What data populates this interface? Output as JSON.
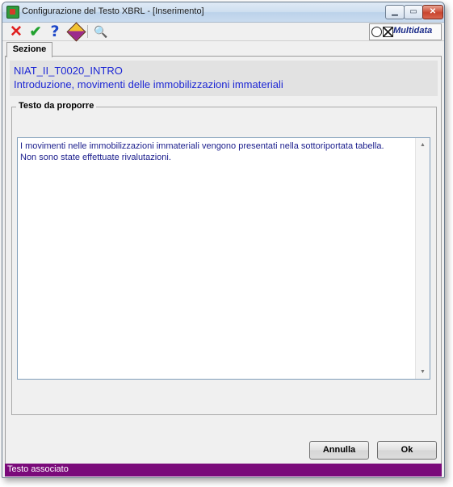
{
  "window": {
    "title": "Configurazione del Testo XBRL - [Inserimento]",
    "controls": {
      "minimize": "▁",
      "maximize": "▭",
      "close": "✕"
    }
  },
  "toolbar": {
    "buttons": [
      {
        "icon": "close-x-icon",
        "glyph": "✕"
      },
      {
        "icon": "confirm-check-icon",
        "glyph": "✔"
      },
      {
        "icon": "help-icon",
        "glyph": "?"
      },
      {
        "icon": "book-icon",
        "glyph": ""
      },
      {
        "icon": "binoculars-icon",
        "glyph": "🔍"
      }
    ],
    "brand": "Multidata"
  },
  "tabs": [
    {
      "label": "Sezione"
    }
  ],
  "section": {
    "code": "NIAT_II_T0020_INTRO",
    "title": "Introduzione, movimenti delle immobilizzazioni immateriali"
  },
  "group": {
    "legend": "Testo da proporre",
    "text": "I movimenti nelle immobilizzazioni immateriali vengono presentati nella sottoriportata tabella.\nNon sono state effettuate rivalutazioni."
  },
  "buttons": {
    "cancel": "Annulla",
    "ok": "Ok"
  },
  "status": {
    "text": "Testo associato"
  },
  "colors": {
    "section_text": "#1d27d5",
    "status_bar": "#7a0a7a",
    "body_text": "#1a1d8c"
  }
}
